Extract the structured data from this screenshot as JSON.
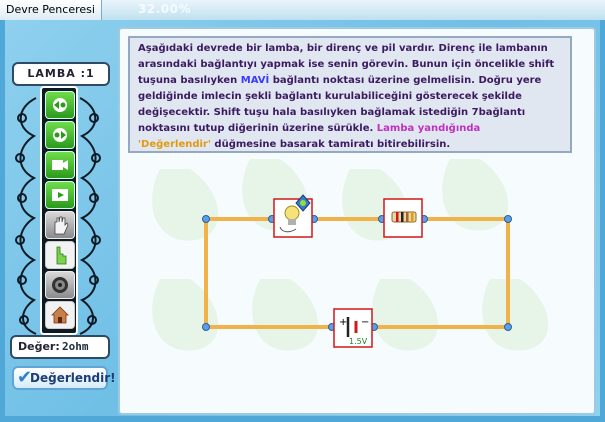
{
  "window": {
    "title": "Devre Penceresi",
    "progress": "32.00%"
  },
  "left_panel": {
    "lamp_count_label": "LAMBA :1",
    "tools": [
      {
        "icon": "connect-left-icon"
      },
      {
        "icon": "connect-right-icon"
      },
      {
        "icon": "camera-icon"
      },
      {
        "icon": "film-icon"
      },
      {
        "icon": "hand-stop-icon"
      },
      {
        "icon": "hand-pointer-icon"
      },
      {
        "icon": "speaker-icon"
      },
      {
        "icon": "home-icon"
      }
    ],
    "value_label": "Değer:",
    "value": "2ohm",
    "evaluate_button": "Değerlendir!"
  },
  "instruction": {
    "part1": "Aşağıdaki devrede bir lamba, bir direnç ve pil vardır.  Direnç ile lambanın arasındaki bağlantıyı yapmak ise senin  görevin.  Bunun için öncelikle shift tuşuna basılıyken ",
    "highlight_blue": "MAVİ",
    "part2": "  bağlantı noktası üzerine gelmelisin.  Doğru yere geldiğinde  imlecin şekli bağlantı kurulabiliceğini gösterecek şekilde değişecektir.  Shift tuşu hala basılıyken bağlamak istediğin  7bağlantı noktasını tutup diğerinin üzerine sürükle. ",
    "highlight_pink": "Lamba  yandığında",
    "highlight_orange": "'Değerlendir'",
    "part3": " düğmesine basarak tamiratı bitirebilirsin."
  },
  "circuit": {
    "battery_label": "1.5V",
    "components": [
      "lamp",
      "resistor",
      "battery"
    ],
    "colors": {
      "wire": "#f2b24a",
      "node": "#5aa0e8",
      "component_border": "#d01818"
    }
  }
}
